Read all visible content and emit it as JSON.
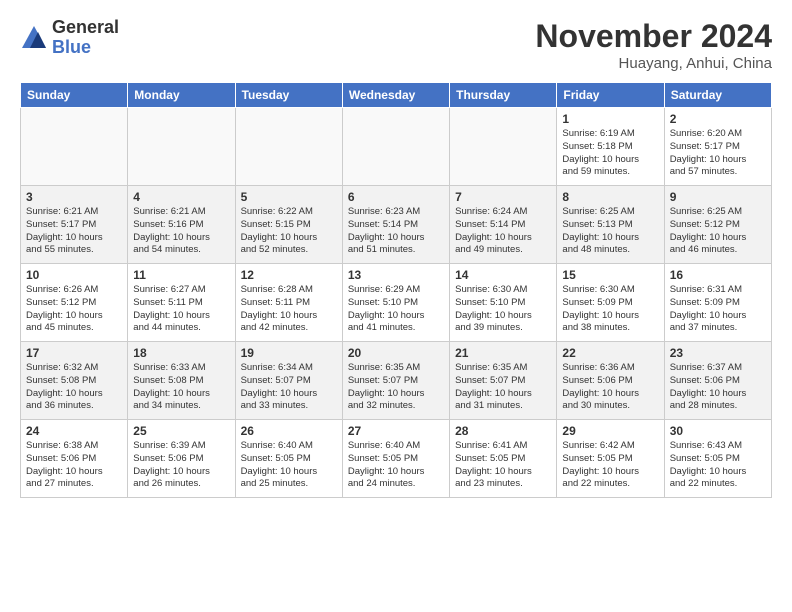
{
  "logo": {
    "general": "General",
    "blue": "Blue"
  },
  "title": "November 2024",
  "location": "Huayang, Anhui, China",
  "days_of_week": [
    "Sunday",
    "Monday",
    "Tuesday",
    "Wednesday",
    "Thursday",
    "Friday",
    "Saturday"
  ],
  "weeks": [
    {
      "alt": false,
      "days": [
        {
          "num": "",
          "info": ""
        },
        {
          "num": "",
          "info": ""
        },
        {
          "num": "",
          "info": ""
        },
        {
          "num": "",
          "info": ""
        },
        {
          "num": "",
          "info": ""
        },
        {
          "num": "1",
          "info": "Sunrise: 6:19 AM\nSunset: 5:18 PM\nDaylight: 10 hours\nand 59 minutes."
        },
        {
          "num": "2",
          "info": "Sunrise: 6:20 AM\nSunset: 5:17 PM\nDaylight: 10 hours\nand 57 minutes."
        }
      ]
    },
    {
      "alt": true,
      "days": [
        {
          "num": "3",
          "info": "Sunrise: 6:21 AM\nSunset: 5:17 PM\nDaylight: 10 hours\nand 55 minutes."
        },
        {
          "num": "4",
          "info": "Sunrise: 6:21 AM\nSunset: 5:16 PM\nDaylight: 10 hours\nand 54 minutes."
        },
        {
          "num": "5",
          "info": "Sunrise: 6:22 AM\nSunset: 5:15 PM\nDaylight: 10 hours\nand 52 minutes."
        },
        {
          "num": "6",
          "info": "Sunrise: 6:23 AM\nSunset: 5:14 PM\nDaylight: 10 hours\nand 51 minutes."
        },
        {
          "num": "7",
          "info": "Sunrise: 6:24 AM\nSunset: 5:14 PM\nDaylight: 10 hours\nand 49 minutes."
        },
        {
          "num": "8",
          "info": "Sunrise: 6:25 AM\nSunset: 5:13 PM\nDaylight: 10 hours\nand 48 minutes."
        },
        {
          "num": "9",
          "info": "Sunrise: 6:25 AM\nSunset: 5:12 PM\nDaylight: 10 hours\nand 46 minutes."
        }
      ]
    },
    {
      "alt": false,
      "days": [
        {
          "num": "10",
          "info": "Sunrise: 6:26 AM\nSunset: 5:12 PM\nDaylight: 10 hours\nand 45 minutes."
        },
        {
          "num": "11",
          "info": "Sunrise: 6:27 AM\nSunset: 5:11 PM\nDaylight: 10 hours\nand 44 minutes."
        },
        {
          "num": "12",
          "info": "Sunrise: 6:28 AM\nSunset: 5:11 PM\nDaylight: 10 hours\nand 42 minutes."
        },
        {
          "num": "13",
          "info": "Sunrise: 6:29 AM\nSunset: 5:10 PM\nDaylight: 10 hours\nand 41 minutes."
        },
        {
          "num": "14",
          "info": "Sunrise: 6:30 AM\nSunset: 5:10 PM\nDaylight: 10 hours\nand 39 minutes."
        },
        {
          "num": "15",
          "info": "Sunrise: 6:30 AM\nSunset: 5:09 PM\nDaylight: 10 hours\nand 38 minutes."
        },
        {
          "num": "16",
          "info": "Sunrise: 6:31 AM\nSunset: 5:09 PM\nDaylight: 10 hours\nand 37 minutes."
        }
      ]
    },
    {
      "alt": true,
      "days": [
        {
          "num": "17",
          "info": "Sunrise: 6:32 AM\nSunset: 5:08 PM\nDaylight: 10 hours\nand 36 minutes."
        },
        {
          "num": "18",
          "info": "Sunrise: 6:33 AM\nSunset: 5:08 PM\nDaylight: 10 hours\nand 34 minutes."
        },
        {
          "num": "19",
          "info": "Sunrise: 6:34 AM\nSunset: 5:07 PM\nDaylight: 10 hours\nand 33 minutes."
        },
        {
          "num": "20",
          "info": "Sunrise: 6:35 AM\nSunset: 5:07 PM\nDaylight: 10 hours\nand 32 minutes."
        },
        {
          "num": "21",
          "info": "Sunrise: 6:35 AM\nSunset: 5:07 PM\nDaylight: 10 hours\nand 31 minutes."
        },
        {
          "num": "22",
          "info": "Sunrise: 6:36 AM\nSunset: 5:06 PM\nDaylight: 10 hours\nand 30 minutes."
        },
        {
          "num": "23",
          "info": "Sunrise: 6:37 AM\nSunset: 5:06 PM\nDaylight: 10 hours\nand 28 minutes."
        }
      ]
    },
    {
      "alt": false,
      "days": [
        {
          "num": "24",
          "info": "Sunrise: 6:38 AM\nSunset: 5:06 PM\nDaylight: 10 hours\nand 27 minutes."
        },
        {
          "num": "25",
          "info": "Sunrise: 6:39 AM\nSunset: 5:06 PM\nDaylight: 10 hours\nand 26 minutes."
        },
        {
          "num": "26",
          "info": "Sunrise: 6:40 AM\nSunset: 5:05 PM\nDaylight: 10 hours\nand 25 minutes."
        },
        {
          "num": "27",
          "info": "Sunrise: 6:40 AM\nSunset: 5:05 PM\nDaylight: 10 hours\nand 24 minutes."
        },
        {
          "num": "28",
          "info": "Sunrise: 6:41 AM\nSunset: 5:05 PM\nDaylight: 10 hours\nand 23 minutes."
        },
        {
          "num": "29",
          "info": "Sunrise: 6:42 AM\nSunset: 5:05 PM\nDaylight: 10 hours\nand 22 minutes."
        },
        {
          "num": "30",
          "info": "Sunrise: 6:43 AM\nSunset: 5:05 PM\nDaylight: 10 hours\nand 22 minutes."
        }
      ]
    }
  ]
}
